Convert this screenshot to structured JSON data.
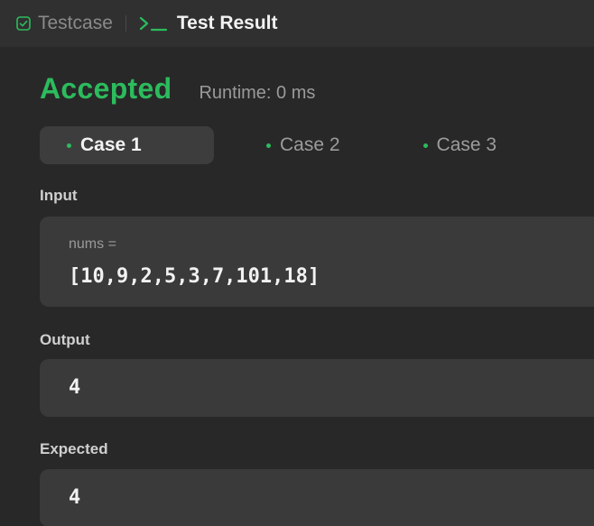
{
  "tabs": {
    "testcase_label": "Testcase",
    "result_label": "Test Result"
  },
  "result": {
    "status": "Accepted",
    "runtime": "Runtime: 0 ms"
  },
  "cases": [
    {
      "label": "Case 1"
    },
    {
      "label": "Case 2"
    },
    {
      "label": "Case 3"
    }
  ],
  "input": {
    "label": "Input",
    "param_name": "nums =",
    "param_value": "[10,9,2,5,3,7,101,18]"
  },
  "output": {
    "label": "Output",
    "value": "4"
  },
  "expected": {
    "label": "Expected",
    "value": "4"
  },
  "colors": {
    "accent_green": "#2cbb5d",
    "background": "#282828",
    "panel": "#3a3a3a"
  },
  "icons": {
    "testcase": "checkbox-icon",
    "result": "terminal-prompt-icon",
    "case_status": "dot-icon"
  }
}
